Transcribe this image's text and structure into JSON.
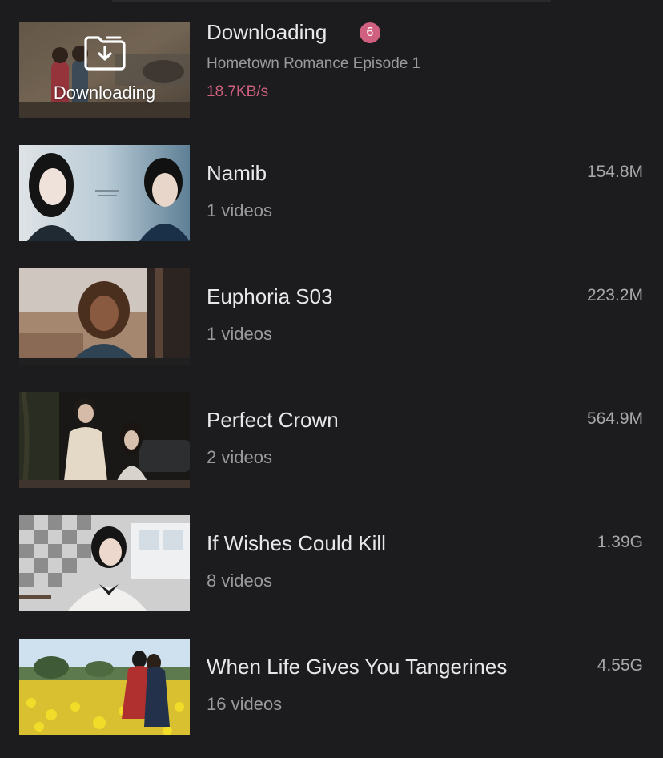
{
  "downloading": {
    "title": "Downloading",
    "badge_count": "6",
    "episode": "Hometown Romance Episode 1",
    "speed": "18.7KB/s",
    "thumb_label": "Downloading",
    "accent_color": "#d0607f"
  },
  "items": [
    {
      "title": "Namib",
      "count": "1 videos",
      "size": "154.8M"
    },
    {
      "title": "Euphoria S03",
      "count": "1 videos",
      "size": "223.2M"
    },
    {
      "title": "Perfect Crown",
      "count": "2 videos",
      "size": "564.9M"
    },
    {
      "title": "If Wishes Could Kill",
      "count": "8 videos",
      "size": "1.39G"
    },
    {
      "title": "When Life Gives You Tangerines",
      "count": "16 videos",
      "size": "4.55G"
    }
  ],
  "icons": {
    "download_folder": "folder-download-icon"
  }
}
